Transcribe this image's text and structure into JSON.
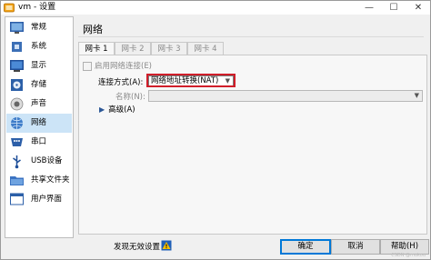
{
  "window": {
    "title": "vm - 设置",
    "minimize": "—",
    "maximize": "☐",
    "close": "✕"
  },
  "sidebar": {
    "items": [
      {
        "label": "常规",
        "icon": "monitor-icon"
      },
      {
        "label": "系统",
        "icon": "chip-icon"
      },
      {
        "label": "显示",
        "icon": "display-icon"
      },
      {
        "label": "存储",
        "icon": "disk-icon"
      },
      {
        "label": "声音",
        "icon": "speaker-icon"
      },
      {
        "label": "网络",
        "icon": "network-icon",
        "selected": true
      },
      {
        "label": "串口",
        "icon": "serial-port-icon"
      },
      {
        "label": "USB设备",
        "icon": "usb-icon"
      },
      {
        "label": "共享文件夹",
        "icon": "folder-icon"
      },
      {
        "label": "用户界面",
        "icon": "window-icon"
      }
    ]
  },
  "main": {
    "title": "网络",
    "tabs": [
      {
        "label": "网卡 1",
        "active": true
      },
      {
        "label": "网卡 2"
      },
      {
        "label": "网卡 3"
      },
      {
        "label": "网卡 4"
      }
    ],
    "enable_label": "启用网络连接(E)",
    "attach_label": "连接方式(A):",
    "attach_value": "网络地址转换(NAT)",
    "name_label": "名称(N):",
    "name_value": "",
    "advanced_label": "高级(A)"
  },
  "footer": {
    "warning_text": "发现无效设置",
    "ok": "确定",
    "cancel": "取消",
    "help": "帮助(H)"
  },
  "watermark": "CSDN @mokou",
  "colors": {
    "selected_bg": "#cce4f7",
    "highlight_border": "#d01e2a",
    "accent": "#0078d7"
  }
}
